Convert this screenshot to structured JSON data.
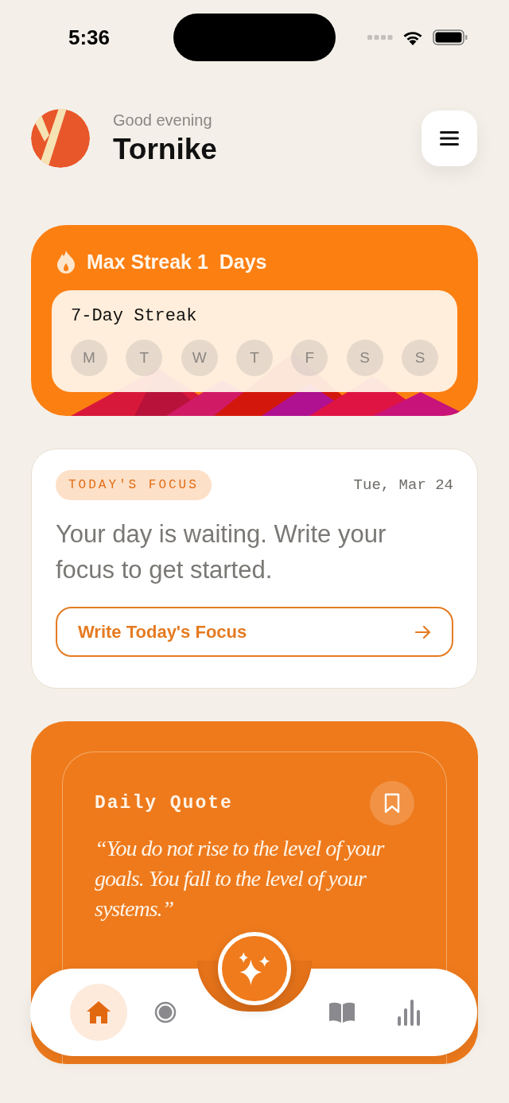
{
  "status_bar": {
    "time": "5:36"
  },
  "header": {
    "greeting": "Good evening",
    "name": "Tornike"
  },
  "streak": {
    "title": "Max Streak 1  Days",
    "card_title": "7-Day Streak",
    "days": [
      "M",
      "T",
      "W",
      "T",
      "F",
      "S",
      "S"
    ]
  },
  "focus": {
    "badge": "TODAY'S FOCUS",
    "date": "Tue, Mar 24",
    "prompt": "Your day is waiting. Write your focus to get started.",
    "button": "Write Today's Focus"
  },
  "quote": {
    "title": "Daily Quote",
    "text": "“You do not rise to the level of your goals. You fall to the level of your systems.”"
  },
  "tab_bar": {
    "items": [
      {
        "kind": "home",
        "selected": true
      },
      {
        "kind": "record",
        "selected": false
      },
      {
        "kind": "journal",
        "selected": false
      },
      {
        "kind": "stats",
        "selected": false
      }
    ]
  }
}
